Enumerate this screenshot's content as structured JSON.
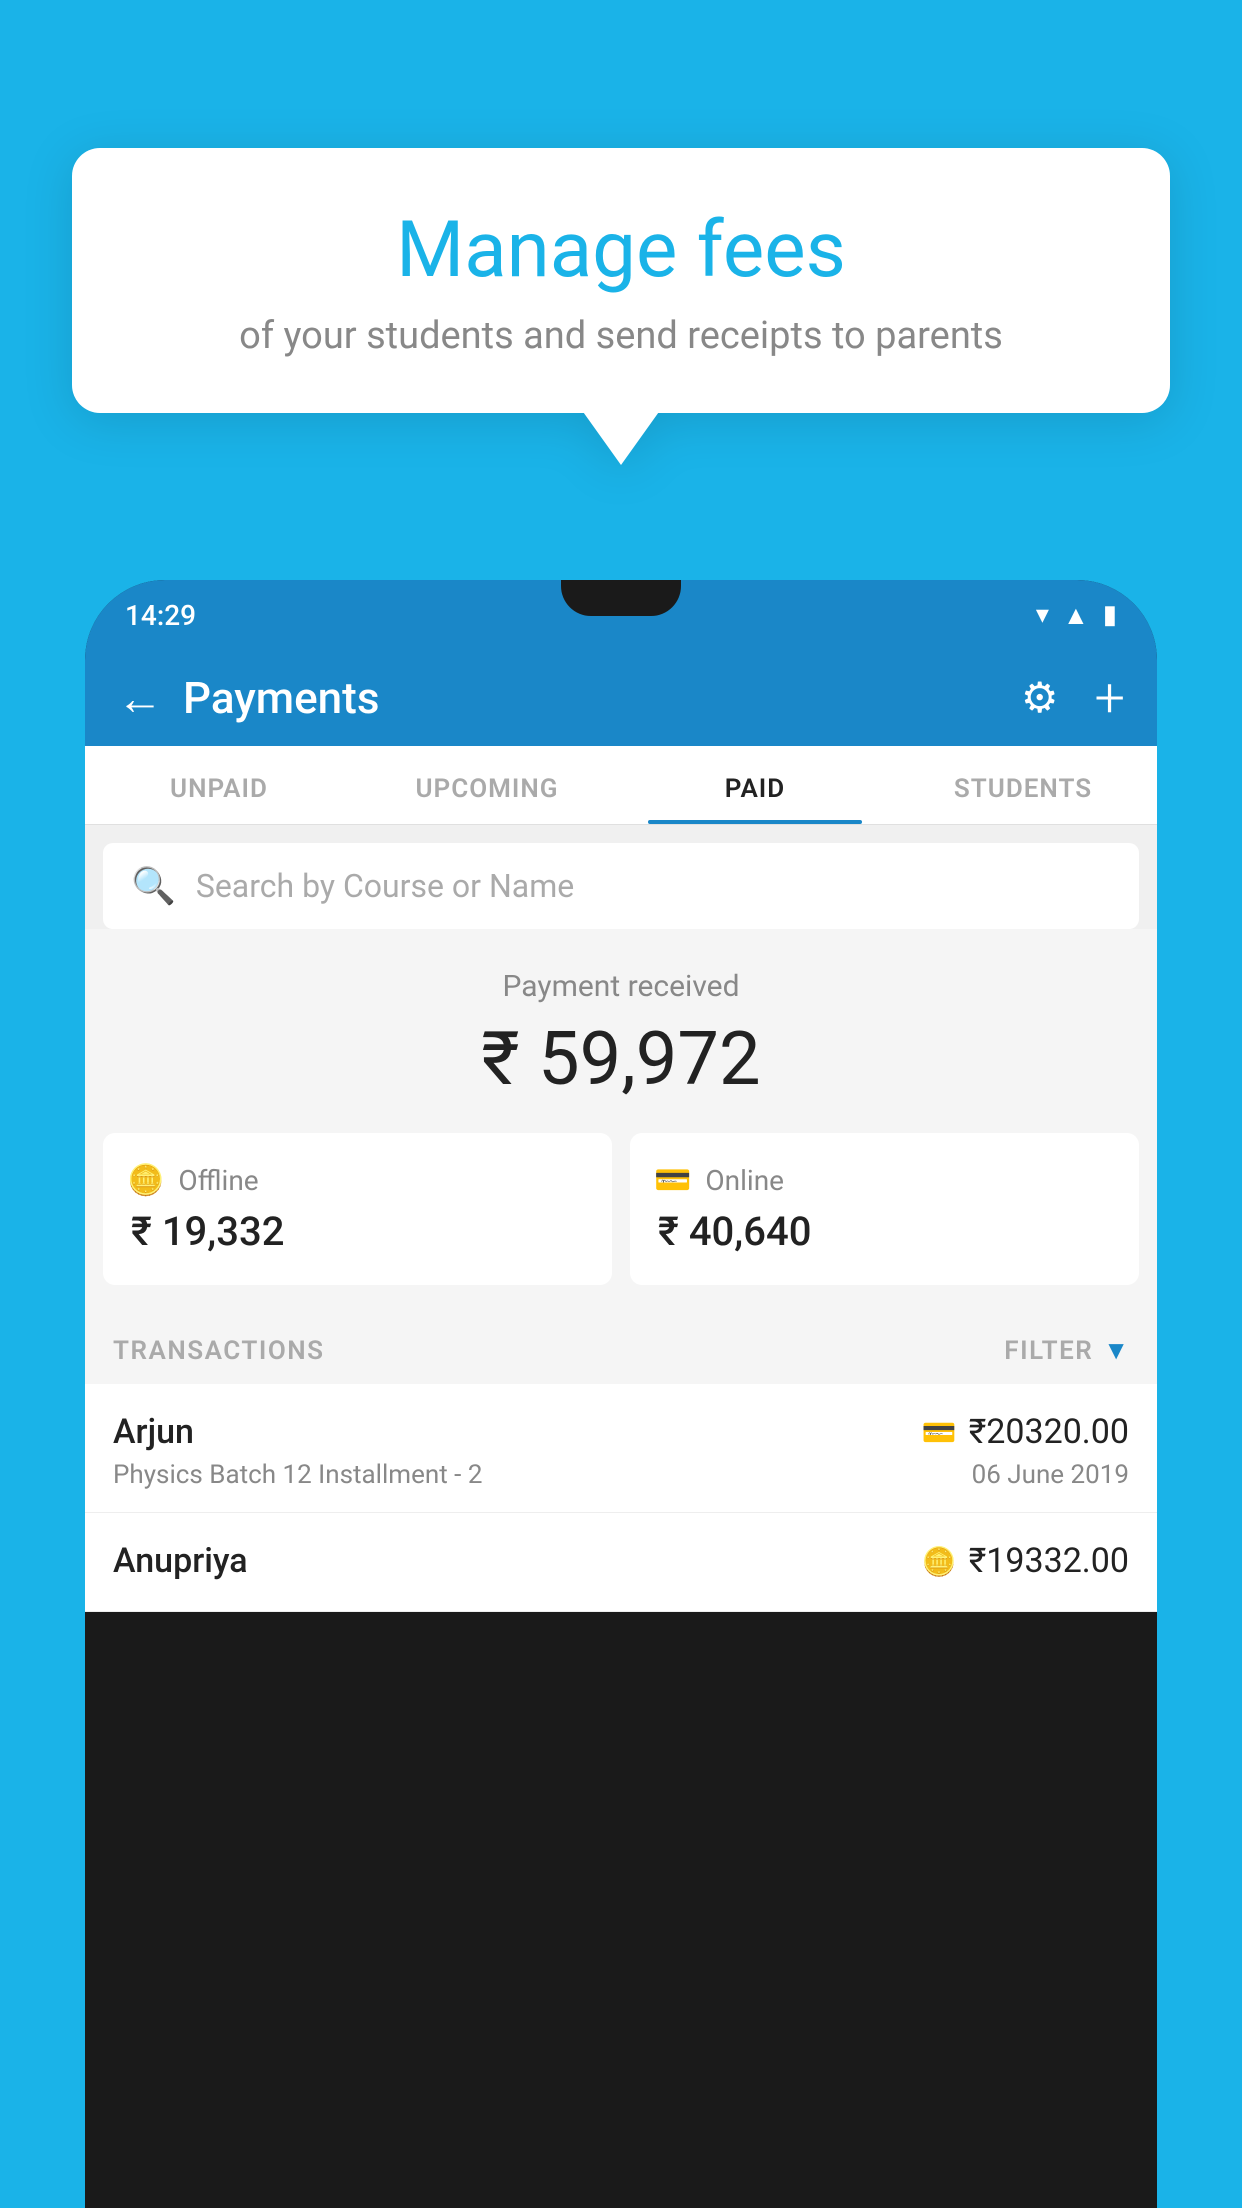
{
  "background_color": "#1ab3e8",
  "bubble": {
    "title": "Manage fees",
    "subtitle": "of your students and send receipts to parents"
  },
  "phone": {
    "status_bar": {
      "time": "14:29"
    },
    "header": {
      "title": "Payments",
      "back_label": "←",
      "gear_label": "⚙",
      "plus_label": "+"
    },
    "tabs": [
      {
        "label": "UNPAID",
        "active": false
      },
      {
        "label": "UPCOMING",
        "active": false
      },
      {
        "label": "PAID",
        "active": true
      },
      {
        "label": "STUDENTS",
        "active": false
      }
    ],
    "search": {
      "placeholder": "Search by Course or Name",
      "icon": "🔍"
    },
    "payment_summary": {
      "label": "Payment received",
      "amount": "₹ 59,972",
      "offline_label": "Offline",
      "offline_amount": "₹ 19,332",
      "online_label": "Online",
      "online_amount": "₹ 40,640"
    },
    "transactions": {
      "header_label": "TRANSACTIONS",
      "filter_label": "FILTER",
      "items": [
        {
          "name": "Arjun",
          "course": "Physics Batch 12 Installment - 2",
          "amount": "₹20320.00",
          "date": "06 June 2019",
          "payment_type": "online"
        },
        {
          "name": "Anupriya",
          "course": "",
          "amount": "₹19332.00",
          "date": "",
          "payment_type": "offline"
        }
      ]
    }
  }
}
